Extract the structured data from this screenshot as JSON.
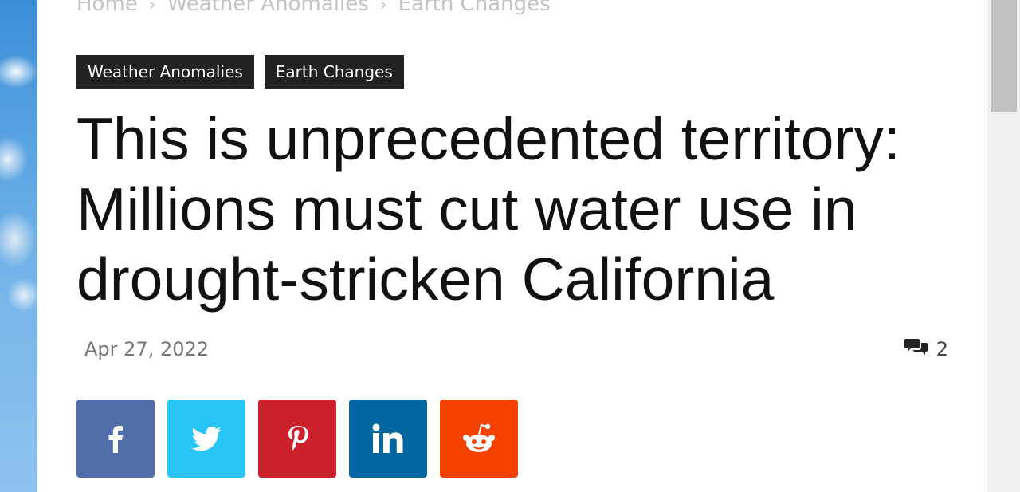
{
  "breadcrumb": {
    "items": [
      "Home",
      "Weather Anomalies",
      "Earth Changes"
    ]
  },
  "tags": [
    "Weather Anomalies",
    "Earth Changes"
  ],
  "article": {
    "title": "This is unprecedented territory: Millions must cut water use in drought-stricken California",
    "date": "Apr 27, 2022",
    "comment_count": "2"
  },
  "share": [
    {
      "network": "facebook",
      "icon": "facebook-icon",
      "color": "#516eab"
    },
    {
      "network": "twitter",
      "icon": "twitter-icon",
      "color": "#29c5f6"
    },
    {
      "network": "pinterest",
      "icon": "pinterest-icon",
      "color": "#ca212a"
    },
    {
      "network": "linkedin",
      "icon": "linkedin-icon",
      "color": "#0266a0"
    },
    {
      "network": "reddit",
      "icon": "reddit-icon",
      "color": "#f54200"
    }
  ],
  "colors": {
    "tag_bg": "#222222",
    "breadcrumb_text": "#c3c3c3",
    "meta_text": "#767676"
  }
}
